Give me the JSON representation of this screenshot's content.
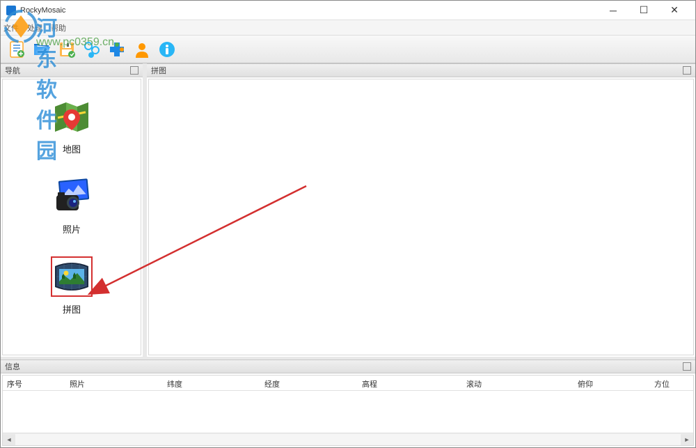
{
  "window": {
    "title": "RockyMosaic"
  },
  "menubar": {
    "items": [
      "文件",
      "处理",
      "帮助"
    ]
  },
  "toolbar": {
    "icons": [
      {
        "name": "new-project-icon"
      },
      {
        "name": "open-icon"
      },
      {
        "name": "save-icon"
      },
      {
        "name": "process-icon"
      },
      {
        "name": "plugin-icon"
      },
      {
        "name": "user-icon"
      },
      {
        "name": "info-icon"
      }
    ]
  },
  "nav_panel": {
    "title": "导航",
    "items": [
      {
        "label": "地图",
        "selected": false,
        "icon": "map"
      },
      {
        "label": "照片",
        "selected": false,
        "icon": "photo"
      },
      {
        "label": "拼图",
        "selected": true,
        "icon": "mosaic"
      }
    ]
  },
  "main_panel": {
    "title": "拼图"
  },
  "info_panel": {
    "title": "信息",
    "columns": [
      "序号",
      "照片",
      "纬度",
      "经度",
      "高程",
      "滚动",
      "俯仰",
      "方位"
    ]
  },
  "watermark": {
    "brand": "河东软件园",
    "url": "www.pc0359.cn"
  }
}
